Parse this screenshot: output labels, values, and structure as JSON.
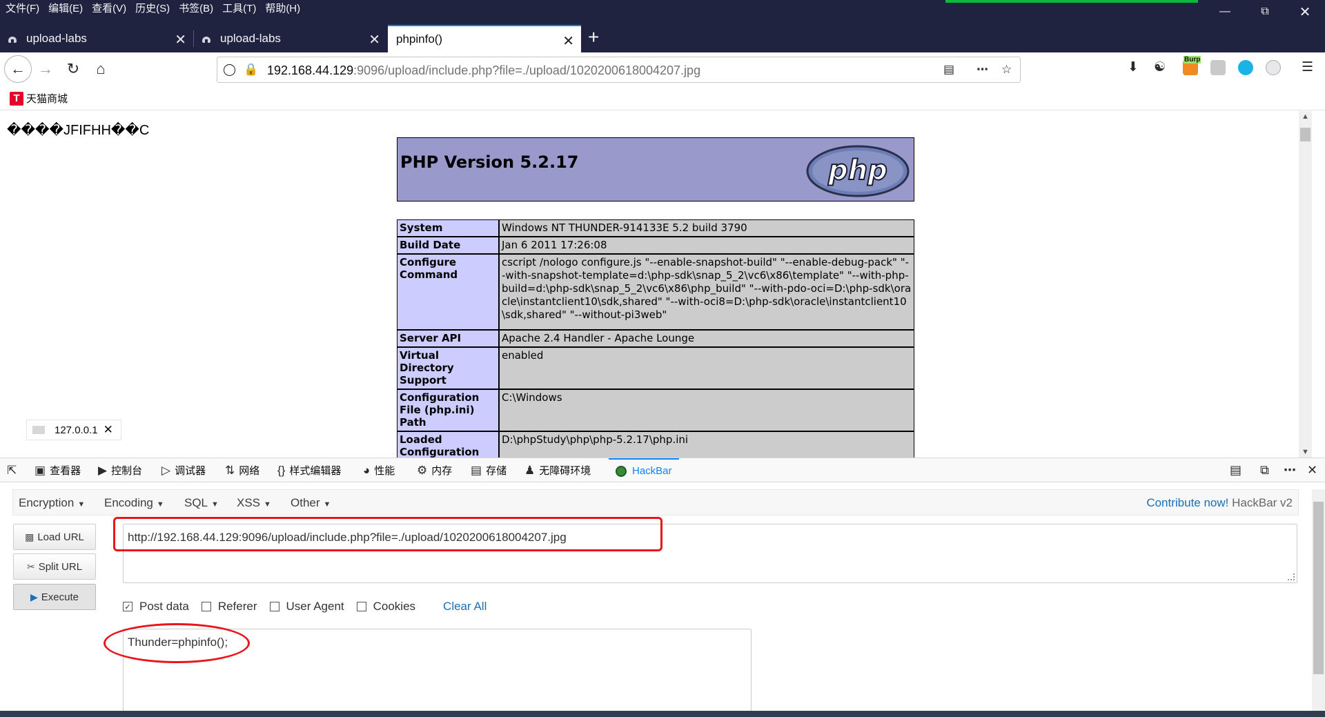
{
  "menubar": [
    "文件(F)",
    "编辑(E)",
    "查看(V)",
    "历史(S)",
    "书签(B)",
    "工具(T)",
    "帮助(H)"
  ],
  "tabs": [
    {
      "title": "upload-labs"
    },
    {
      "title": "upload-labs"
    },
    {
      "title": "phpinfo()"
    }
  ],
  "navbar": {
    "url_host": "192.168.44.129",
    "url_rest": ":9096/upload/include.php?file=./upload/1020200618004207.jpg",
    "ext_burp_label": "Burp"
  },
  "bookmarks": [
    {
      "label": "天猫商城",
      "logo": "T"
    }
  ],
  "page": {
    "garbage_text": "����JFIFHH��C",
    "php_version": "PHP Version 5.2.17",
    "php_logo_text": "php",
    "rows": [
      {
        "key": "System",
        "value": "Windows NT THUNDER-914133E 5.2 build 3790"
      },
      {
        "key": "Build Date",
        "value": "Jan 6 2011 17:26:08"
      },
      {
        "key": "Configure Command",
        "value": "cscript /nologo configure.js \"--enable-snapshot-build\" \"--enable-debug-pack\" \"--with-snapshot-template=d:\\php-sdk\\snap_5_2\\vc6\\x86\\template\" \"--with-php-build=d:\\php-sdk\\snap_5_2\\vc6\\x86\\php_build\" \"--with-pdo-oci=D:\\php-sdk\\oracle\\instantclient10\\sdk,shared\" \"--with-oci8=D:\\php-sdk\\oracle\\instantclient10\\sdk,shared\" \"--without-pi3web\""
      },
      {
        "key": "Server API",
        "value": "Apache 2.4 Handler - Apache Lounge"
      },
      {
        "key": "Virtual Directory Support",
        "value": "enabled"
      },
      {
        "key": "Configuration File (php.ini) Path",
        "value": "C:\\Windows"
      },
      {
        "key": "Loaded Configuration File",
        "value": "D:\\phpStudy\\php\\php-5.2.17\\php.ini"
      }
    ],
    "ip_tooltip": "127.0.0.1"
  },
  "devtools": {
    "tabs": [
      "查看器",
      "控制台",
      "调试器",
      "网络",
      "样式编辑器",
      "性能",
      "内存",
      "存储",
      "无障碍环境",
      "HackBar"
    ]
  },
  "hackbar": {
    "menu": [
      "Encryption",
      "Encoding",
      "SQL",
      "XSS",
      "Other"
    ],
    "contribute_link": "Contribute now!",
    "version": "HackBar v2",
    "buttons": {
      "load": "Load URL",
      "split": "Split URL",
      "execute": "Execute"
    },
    "url_value": "http://192.168.44.129:9096/upload/include.php?file=./upload/1020200618004207.jpg",
    "checks": [
      {
        "label": "Post data",
        "checked": true
      },
      {
        "label": "Referer",
        "checked": false
      },
      {
        "label": "User Agent",
        "checked": false
      },
      {
        "label": "Cookies",
        "checked": false
      }
    ],
    "clear_all": "Clear All",
    "post_value": "Thunder=phpinfo();"
  },
  "colors": {
    "titlebar": "#202340",
    "accent": "#0a84ff",
    "php_header": "#9999cc",
    "php_key": "#ccccff",
    "php_value": "#cccccc",
    "annotation": "#e8151b"
  }
}
